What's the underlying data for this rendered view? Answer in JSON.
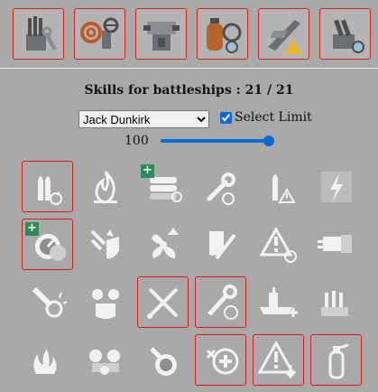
{
  "categories": [
    {
      "name": "AA & secondary guns",
      "icon": "aa-gun-wrench-icon",
      "selected": true
    },
    {
      "name": "Damage control",
      "icon": "hose-valve-icon",
      "selected": true
    },
    {
      "name": "Main battery",
      "icon": "turret-machinery-icon",
      "selected": true
    },
    {
      "name": "Engine & survival",
      "icon": "tank-gauge-icon",
      "selected": true
    },
    {
      "name": "Aircraft",
      "icon": "plane-warning-icon",
      "selected": true
    },
    {
      "name": "Artillery",
      "icon": "gun-turret-icon",
      "selected": true
    }
  ],
  "header": {
    "title": "Skills for battleships : 21 / 21"
  },
  "commander": {
    "selected": "Jack Dunkirk",
    "select_limit_label": "Select Limit",
    "select_limit_checked": true
  },
  "points": {
    "label": "100",
    "level": 1.0
  },
  "skills": [
    {
      "icon": "shells-reload-icon",
      "selected": true,
      "plus": false
    },
    {
      "icon": "fire-icon",
      "selected": false,
      "plus": false
    },
    {
      "icon": "torpedo-tubes-icon",
      "selected": false,
      "plus": true
    },
    {
      "icon": "wrench-reload-icon",
      "selected": false,
      "plus": false
    },
    {
      "icon": "shell-warning-icon",
      "selected": false,
      "plus": false
    },
    {
      "icon": "lightning-icon",
      "selected": false,
      "plus": false
    },
    {
      "icon": "gauge-dial-icon",
      "selected": true,
      "plus": true
    },
    {
      "icon": "explosion-shield-icon",
      "selected": false,
      "plus": false
    },
    {
      "icon": "propeller-up-icon",
      "selected": false,
      "plus": false
    },
    {
      "icon": "shield-wrench-icon",
      "selected": false,
      "plus": false
    },
    {
      "icon": "warning-crosshair-icon",
      "selected": false,
      "plus": false
    },
    {
      "icon": "turret-barrel-icon",
      "selected": false,
      "plus": false
    },
    {
      "icon": "shell-explosion-icon",
      "selected": false,
      "plus": false
    },
    {
      "icon": "turrets-shield-icon",
      "selected": false,
      "plus": false
    },
    {
      "icon": "crossed-tools-icon",
      "selected": true,
      "plus": false
    },
    {
      "icon": "wrench-gauge-icon",
      "selected": true,
      "plus": false
    },
    {
      "icon": "battleship-plus-icon",
      "selected": false,
      "plus": false
    },
    {
      "icon": "guns-turret-icon",
      "selected": false,
      "plus": false
    },
    {
      "icon": "flames-icon",
      "selected": false,
      "plus": false
    },
    {
      "icon": "turrets-row-icon",
      "selected": false,
      "plus": false
    },
    {
      "icon": "turret-crosshair-icon",
      "selected": false,
      "plus": false
    },
    {
      "icon": "repair-plus-icon",
      "selected": true,
      "plus": false
    },
    {
      "icon": "warning-down-icon",
      "selected": true,
      "plus": false
    },
    {
      "icon": "extinguisher-icon",
      "selected": true,
      "plus": false
    }
  ],
  "colors": {
    "accent": "#0b6bd4",
    "selection_border": "#d02020",
    "plus_badge": "#2e8b57",
    "background": "#a9a9a9"
  }
}
